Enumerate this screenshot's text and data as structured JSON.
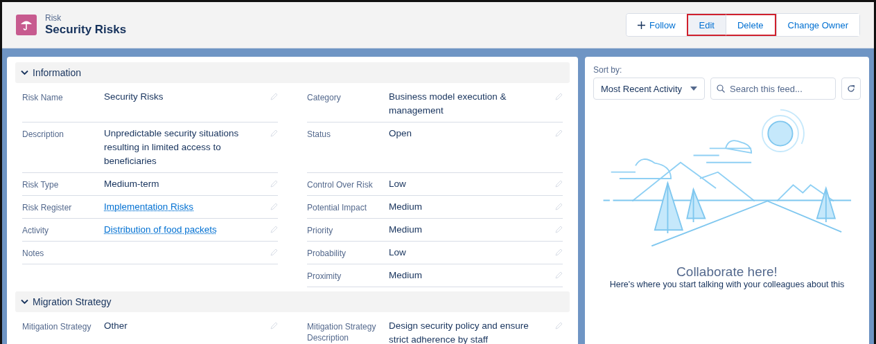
{
  "header": {
    "object_type": "Risk",
    "title": "Security Risks",
    "buttons": [
      {
        "label": "Follow",
        "kind": "follow",
        "highlighted": false,
        "hovered": false
      },
      {
        "label": "Edit",
        "kind": "plain",
        "highlighted": true,
        "hovered": true
      },
      {
        "label": "Delete",
        "kind": "plain",
        "highlighted": true,
        "hovered": false
      },
      {
        "label": "Change Owner",
        "kind": "plain",
        "highlighted": false,
        "hovered": false
      }
    ]
  },
  "sections": [
    {
      "title": "Information",
      "expanded": true,
      "rows": [
        {
          "left": {
            "label": "Risk Name",
            "value": "Security Risks"
          },
          "right": {
            "label": "Category",
            "value": "Business model execution & management"
          }
        },
        {
          "left": {
            "label": "Description",
            "value": "Unpredictable security situations resulting in limited access to beneficiaries"
          },
          "right": {
            "label": "Status",
            "value": "Open"
          }
        },
        {
          "left": {
            "label": "Risk Type",
            "value": "Medium-term"
          },
          "right": {
            "label": "Control Over Risk",
            "value": "Low"
          }
        },
        {
          "left": {
            "label": "Risk Register",
            "value": "Implementation Risks",
            "kind": "link"
          },
          "right": {
            "label": "Potential Impact",
            "value": "Medium"
          }
        },
        {
          "left": {
            "label": "Activity",
            "value": "Distribution of food packets",
            "kind": "link"
          },
          "right": {
            "label": "Priority",
            "value": "Medium"
          }
        },
        {
          "left": {
            "label": "Notes"
          },
          "right": {
            "label": "Probability",
            "value": "Low"
          }
        },
        {
          "right": {
            "label": "Proximity",
            "value": "Medium"
          }
        }
      ]
    },
    {
      "title": "Migration Strategy",
      "expanded": true,
      "rows": [
        {
          "left": {
            "label": "Mitigation Strategy",
            "value": "Other"
          },
          "right": {
            "label": "Mitigation Strategy Description",
            "value": "Design security policy and ensure strict adherence by staff"
          }
        }
      ]
    }
  ],
  "feed": {
    "sort_label": "Sort by:",
    "sort_value": "Most Recent Activity",
    "search": {
      "placeholder": "Search this feed..."
    },
    "empty_title": "Collaborate here!",
    "empty_text": "Here's where you start talking with your colleagues about this"
  }
}
